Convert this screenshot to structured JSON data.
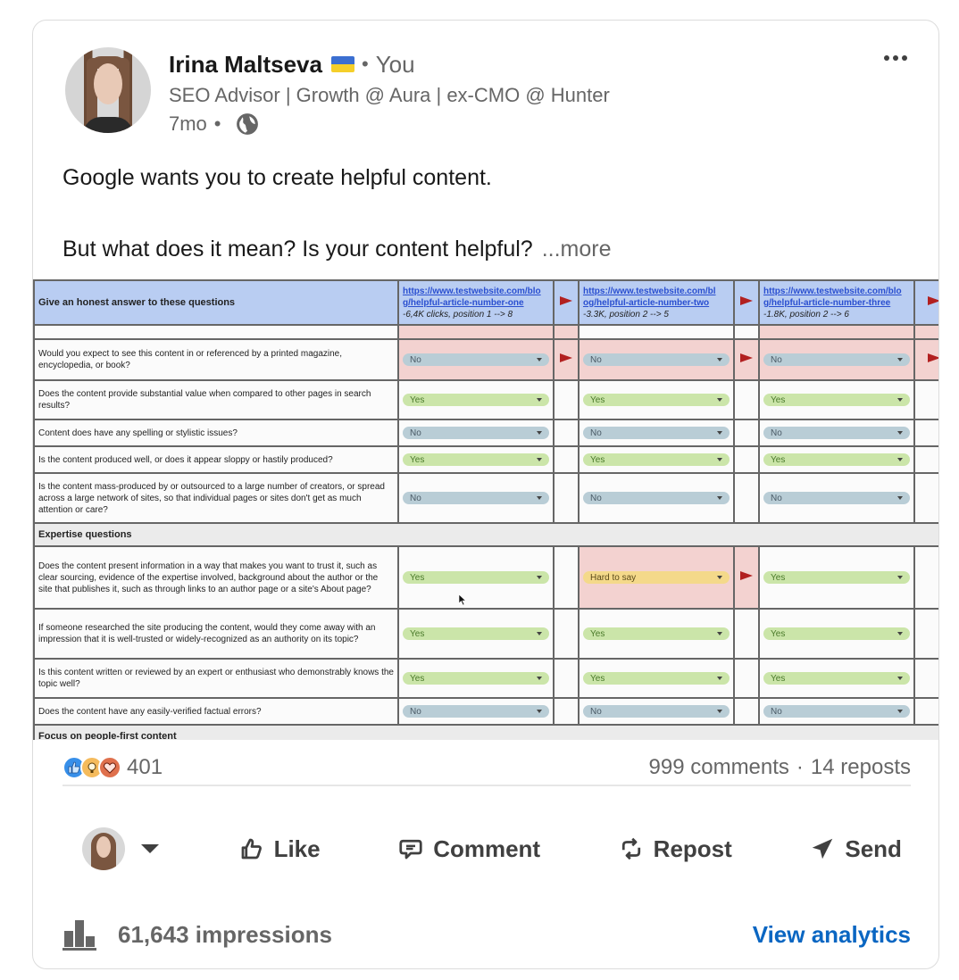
{
  "author": {
    "name": "Irina Maltseva",
    "flag_icon": "ukraine-flag",
    "relation": "You",
    "separator": "•",
    "headline": "SEO Advisor | Growth @ Aura | ex-CMO @ Hunter",
    "time": "7mo",
    "visibility_icon": "globe-icon"
  },
  "menu": {
    "icon": "more-horizontal-icon"
  },
  "post": {
    "line1": "Google wants you to create helpful content.",
    "line2": "But what does it mean? Is your content helpful?",
    "see_more": "...more"
  },
  "sheet": {
    "header_question": "Give an honest answer to these questions",
    "columns": [
      {
        "url": "https://www.testwebsite.com/blog/helpful-article-number-one",
        "url_line1": "https://www.testwebsite.com/blo",
        "url_line2": "g/helpful-article-number-one",
        "delta": "-6,4K clicks, position 1 --> 8"
      },
      {
        "url": "https://www.testwebsite.com/blog/helpful-article-number-two",
        "url_line1": "https://www.testwebsite.com/bl",
        "url_line2": "og/helpful-article-number-two",
        "delta": "-3.3K, position 2 --> 5"
      },
      {
        "url": "https://www.testwebsite.com/blog/helpful-article-number-three",
        "url_line1": "https://www.testwebsite.com/blo",
        "url_line2": "g/helpful-article-number-three",
        "delta": "-1.8K, position 2 --> 6"
      }
    ],
    "rows": [
      {
        "question": "Would you expect to see this content in or referenced by a printed magazine, encyclopedia, or book?",
        "answers": [
          "No",
          "No",
          "No"
        ]
      },
      {
        "question": "Does the content provide substantial value when compared to other pages in search results?",
        "answers": [
          "Yes",
          "Yes",
          "Yes"
        ]
      },
      {
        "question": "Content does have any spelling or stylistic issues?",
        "answers": [
          "No",
          "No",
          "No"
        ]
      },
      {
        "question": "Is the content produced well, or does it appear sloppy or hastily produced?",
        "answers": [
          "Yes",
          "Yes",
          "Yes"
        ]
      },
      {
        "question": "Is the content mass-produced by or outsourced to a large number of creators, or spread across a large network of sites, so that individual pages or sites don't get as much attention or care?",
        "answers": [
          "No",
          "No",
          "No"
        ]
      }
    ],
    "section2_title": "Expertise questions",
    "rows2": [
      {
        "question": "Does the content present information in a way that makes you want to trust it, such as clear sourcing, evidence of the expertise involved, background about the author or the site that publishes it, such as through links to an author page or a site's About page?",
        "answers": [
          "Yes",
          "Hard to say",
          "Yes"
        ]
      },
      {
        "question": "If someone researched the site producing the content, would they come away with an impression that it is well-trusted or widely-recognized as an authority on its topic?",
        "answers": [
          "Yes",
          "Yes",
          "Yes"
        ]
      },
      {
        "question": "Is this content written or reviewed by an expert or enthusiast who demonstrably knows the topic well?",
        "answers": [
          "Yes",
          "Yes",
          "Yes"
        ]
      },
      {
        "question": "Does the content have any easily-verified factual errors?",
        "answers": [
          "No",
          "No",
          "No"
        ]
      }
    ],
    "section3_title": "Focus on people-first content",
    "colors": {
      "header_blue": "#b9cdf2",
      "flag_red": "#b22020",
      "highlight_pink": "#f3d2d0",
      "yes_green": "#cbe5a9",
      "no_blue": "#b9cdd6",
      "hard_yellow": "#f4d98a"
    }
  },
  "social": {
    "reaction_icons": [
      "like-reaction",
      "insightful-reaction",
      "love-reaction"
    ],
    "reaction_count": "401",
    "comments": "999 comments",
    "dot": "·",
    "reposts": "14 reposts"
  },
  "actions": {
    "like": "Like",
    "comment": "Comment",
    "repost": "Repost",
    "send": "Send"
  },
  "footer": {
    "impressions": "61,643 impressions",
    "view_analytics": "View analytics"
  },
  "colors": {
    "link_blue": "#0a66c2",
    "secondary_text": "#666666"
  }
}
